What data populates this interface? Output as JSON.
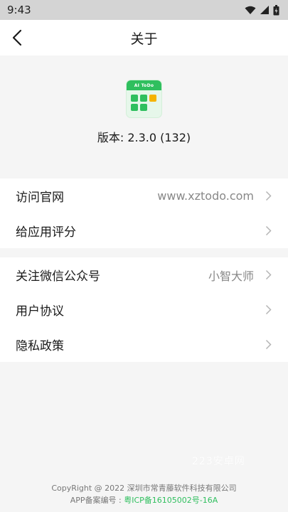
{
  "status": {
    "time": "9:43"
  },
  "header": {
    "title": "关于"
  },
  "app": {
    "icon_label": "AI ToDo",
    "version": "版本: 2.3.0 (132)"
  },
  "links": [
    {
      "label": "访问官网",
      "value": "www.xztodo.com"
    },
    {
      "label": "给应用评分",
      "value": ""
    }
  ],
  "info": [
    {
      "label": "关注微信公众号",
      "value": "小智大师"
    },
    {
      "label": "用户协议",
      "value": ""
    },
    {
      "label": "隐私政策",
      "value": ""
    }
  ],
  "watermark": "223安卓网",
  "footer": {
    "copyright": "CopyRight @ 2022 深圳市常青藤软件科技有限公司",
    "icp_label": "APP备案编号 :",
    "icp_number": "粤ICP备16105002号-16A"
  },
  "colors": {
    "brand_green": "#2fbf5e",
    "accent_yellow": "#f5b300",
    "status_bar": "#d4d4d4",
    "background": "#f5f5f5"
  }
}
